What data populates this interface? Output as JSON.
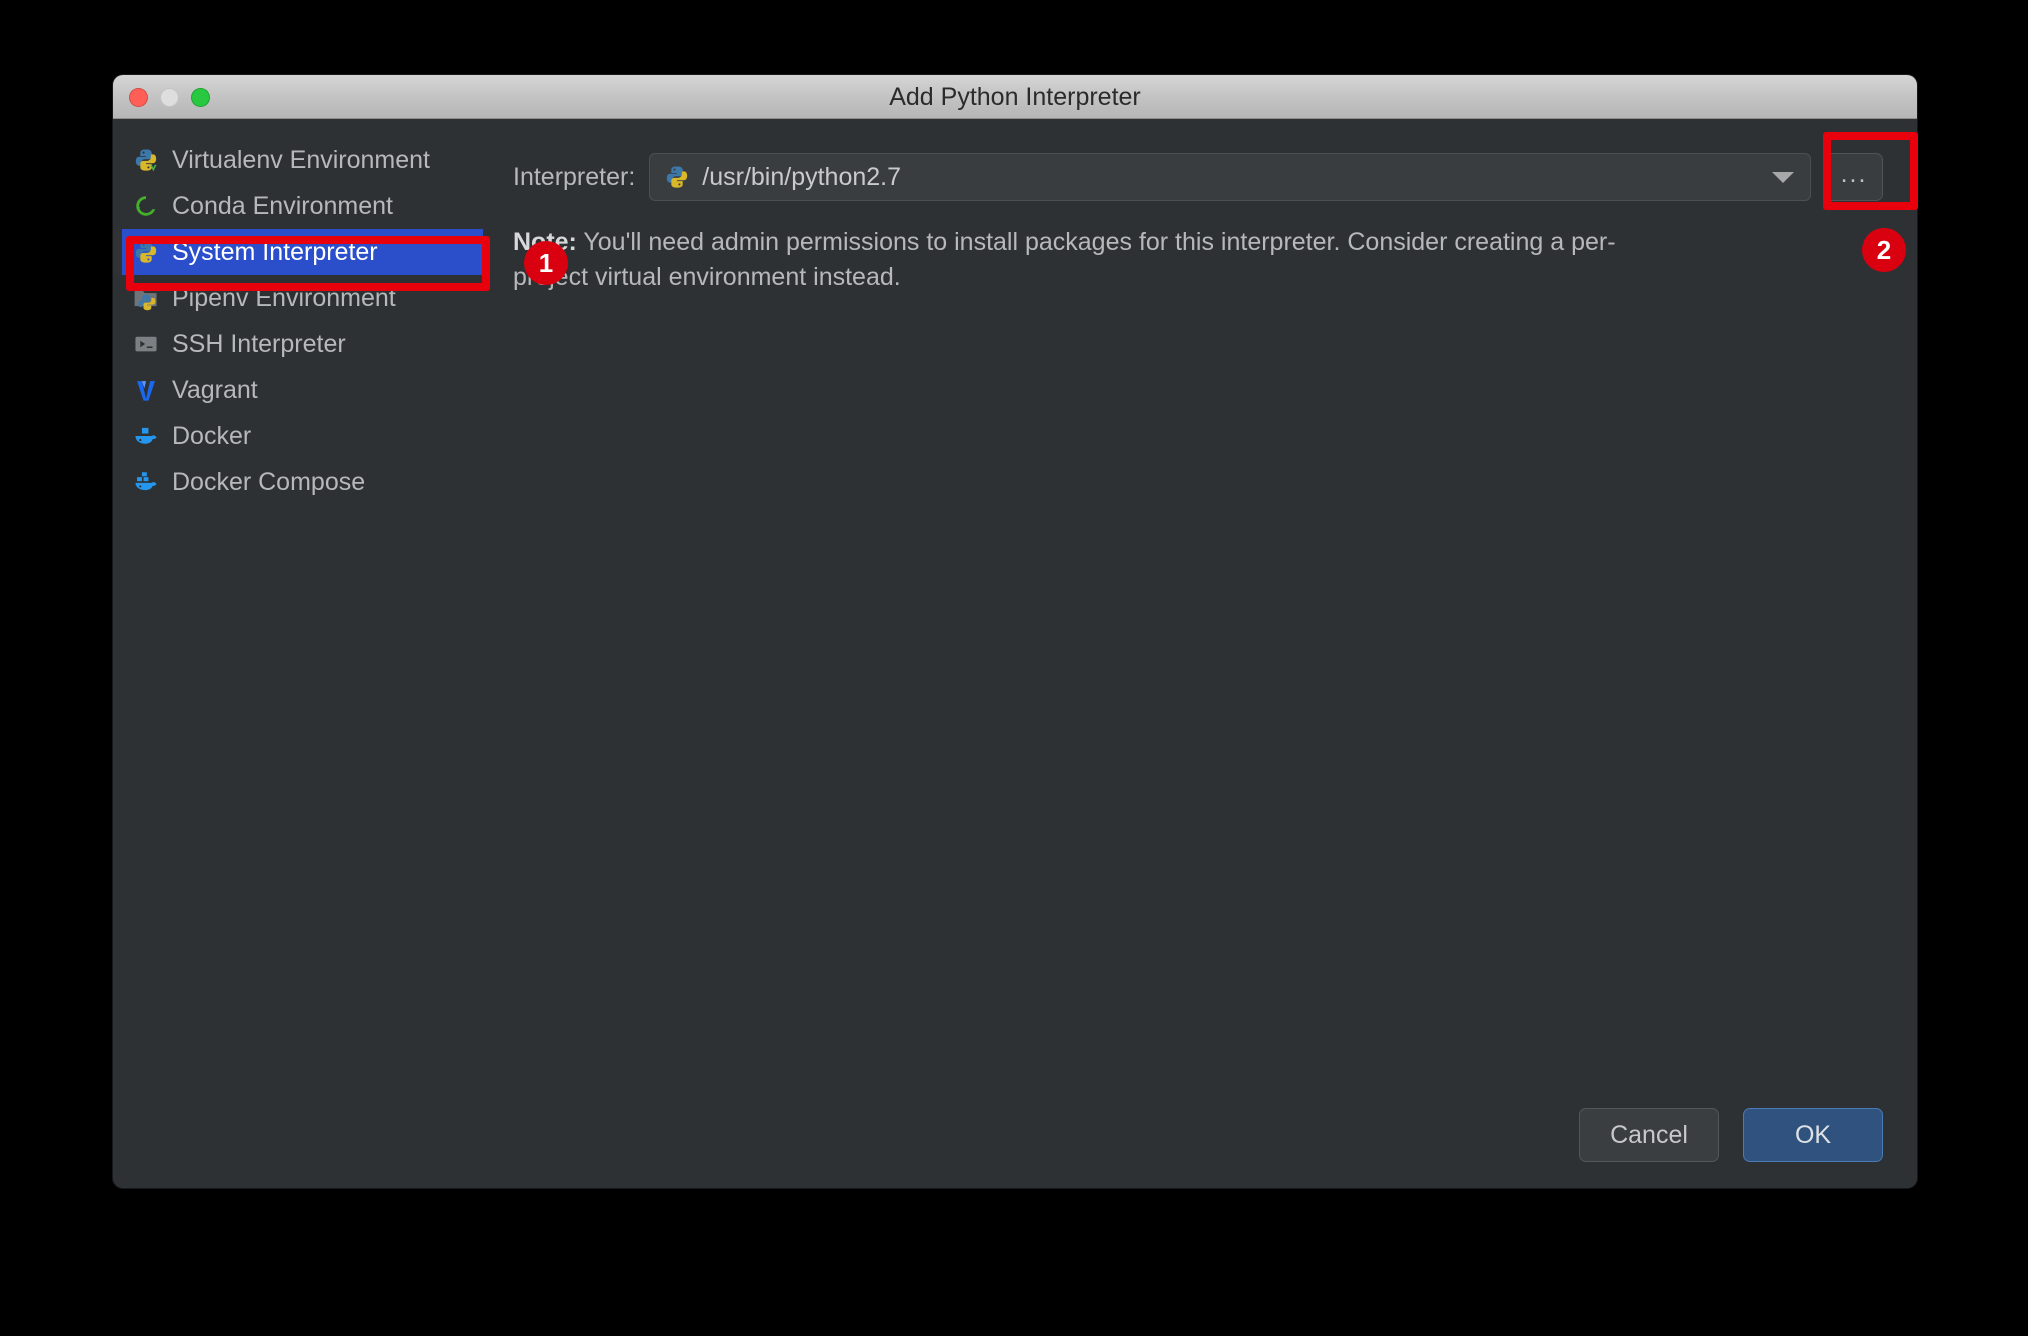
{
  "window": {
    "title": "Add Python Interpreter",
    "traffic_lights": [
      "close",
      "minimize",
      "zoom"
    ]
  },
  "sidebar": {
    "items": [
      {
        "label": "Virtualenv Environment",
        "icon": "python-venv-icon",
        "selected": false
      },
      {
        "label": "Conda Environment",
        "icon": "conda-icon",
        "selected": false
      },
      {
        "label": "System Interpreter",
        "icon": "python-icon",
        "selected": true
      },
      {
        "label": "Pipenv Environment",
        "icon": "pipenv-folder-icon",
        "selected": false
      },
      {
        "label": "SSH Interpreter",
        "icon": "ssh-terminal-icon",
        "selected": false
      },
      {
        "label": "Vagrant",
        "icon": "vagrant-icon",
        "selected": false
      },
      {
        "label": "Docker",
        "icon": "docker-icon",
        "selected": false
      },
      {
        "label": "Docker Compose",
        "icon": "docker-compose-icon",
        "selected": false
      }
    ]
  },
  "main": {
    "interpreter_label": "Interpreter:",
    "interpreter_value": "/usr/bin/python2.7",
    "interpreter_icon": "python-icon",
    "browse_button_label": "...",
    "note_prefix": "Note:",
    "note_text": " You'll need admin permissions to install packages for this interpreter. Consider creating a per-project virtual environment instead."
  },
  "footer": {
    "cancel_label": "Cancel",
    "ok_label": "OK"
  },
  "annotations": {
    "badge_one": "1",
    "badge_two": "2"
  },
  "colors": {
    "selection_blue": "#2b4ecb",
    "annotation_red": "#e8000d",
    "badge_red": "#d9000f",
    "ok_blue": "#2f527f",
    "dialog_bg": "#2e3133",
    "page_bg": "#000000"
  }
}
